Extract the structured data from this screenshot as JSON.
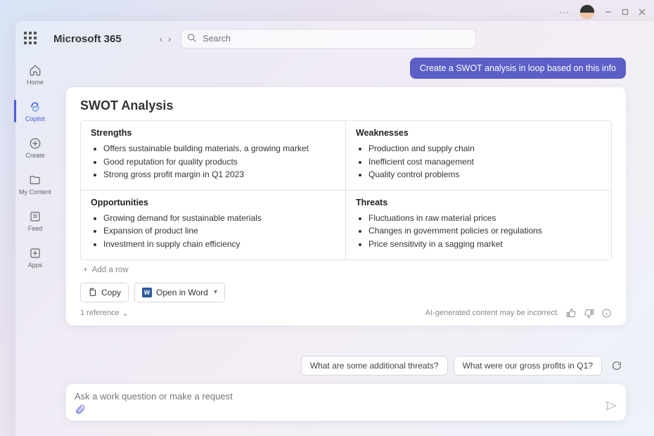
{
  "titlebar": {
    "more": "···"
  },
  "brand": "Microsoft 365",
  "search": {
    "placeholder": "Search"
  },
  "nav": {
    "home": "Home",
    "copilot": "Copilot",
    "create": "Create",
    "mycontent": "My Content",
    "feed": "Feed",
    "apps": "Apps"
  },
  "chat": {
    "user_prompt": "Create a SWOT analysis in loop based on this info",
    "card_title": "SWOT Analysis",
    "strengths_h": "Strengths",
    "strengths": [
      "Offers sustainable building materials, a growing market",
      "Good reputation for quality products",
      "Strong gross profit margin in Q1 2023"
    ],
    "weaknesses_h": "Weaknesses",
    "weaknesses": [
      "Production and supply chain",
      "Inefficient cost management",
      "Quality control problems"
    ],
    "opportunities_h": "Opportunities",
    "opportunities": [
      "Growing demand for sustainable materials",
      "Expansion of product line",
      "Investment in supply chain efficiency"
    ],
    "threats_h": "Threats",
    "threats": [
      "Fluctuations in raw material prices",
      "Changes in government policies or regulations",
      "Price sensitivity in a sagging market"
    ],
    "add_row": "Add a row",
    "copy": "Copy",
    "open_word": "Open in Word",
    "references": "1 reference",
    "disclaimer": "AI-generated content may be incorrect."
  },
  "suggestions": {
    "s1": "What are some additional threats?",
    "s2": "What were our gross profits in Q1?"
  },
  "input": {
    "placeholder": "Ask a work question or make a request"
  }
}
